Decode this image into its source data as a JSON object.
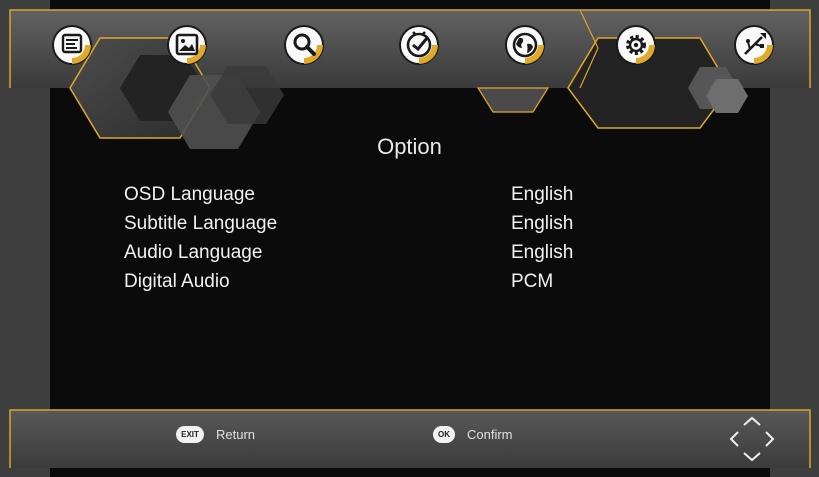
{
  "menu_tabs": [
    {
      "icon": "program-list-icon",
      "active": false
    },
    {
      "icon": "picture-icon",
      "active": false
    },
    {
      "icon": "search-icon",
      "active": false
    },
    {
      "icon": "clock-icon",
      "active": false
    },
    {
      "icon": "globe-icon",
      "active": false
    },
    {
      "icon": "gear-icon",
      "active": true
    },
    {
      "icon": "usb-icon",
      "active": false
    }
  ],
  "page": {
    "title": "Option"
  },
  "options": [
    {
      "label": "OSD Language",
      "value": "English"
    },
    {
      "label": "Subtitle Language",
      "value": "English"
    },
    {
      "label": "Audio Language",
      "value": "English"
    },
    {
      "label": "Digital Audio",
      "value": "PCM"
    }
  ],
  "footer": {
    "exit_key": "EXIT",
    "return_label": "Return",
    "ok_key": "OK",
    "confirm_label": "Confirm"
  },
  "colors": {
    "accent_gold": "#e0a92a",
    "panel_gray": "#4b4b4b",
    "text": "#f2f2f2"
  }
}
